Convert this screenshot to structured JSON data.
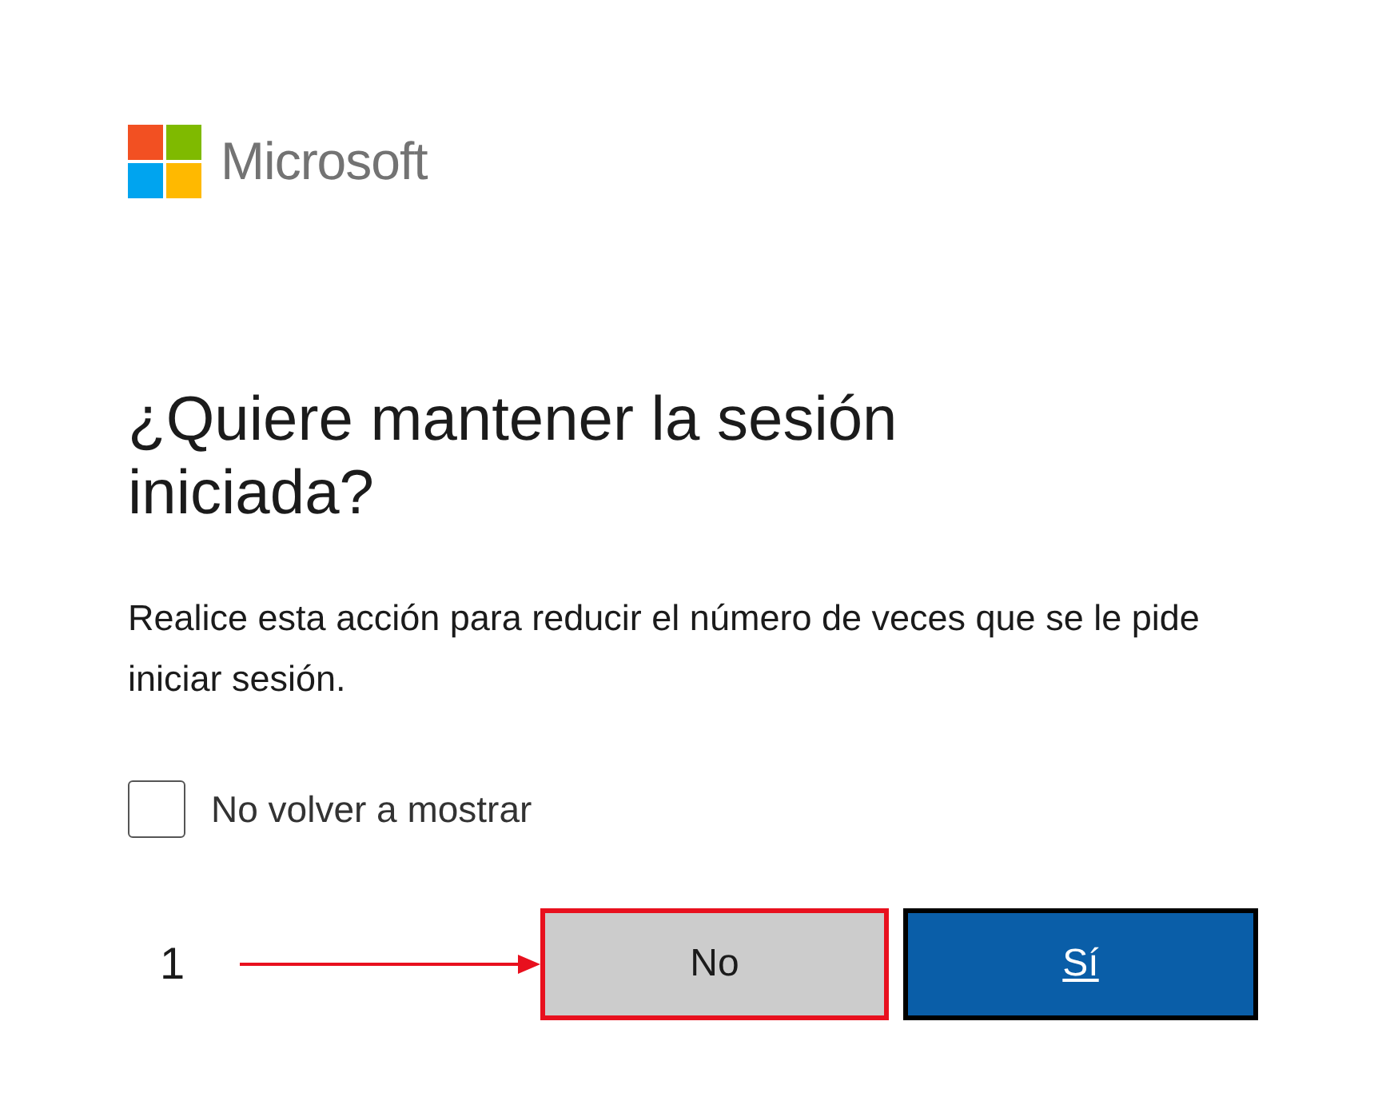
{
  "logo": {
    "text": "Microsoft"
  },
  "title": "¿Quiere mantener la sesión iniciada?",
  "description": "Realice esta acción para reducir el número de veces que se le pide iniciar sesión.",
  "checkbox": {
    "label": "No volver a mostrar",
    "checked": false
  },
  "annotation": {
    "label": "1"
  },
  "buttons": [
    {
      "label": "No",
      "kind": "secondary",
      "highlighted": true
    },
    {
      "label": "Sí",
      "kind": "primary",
      "highlighted": false
    }
  ]
}
